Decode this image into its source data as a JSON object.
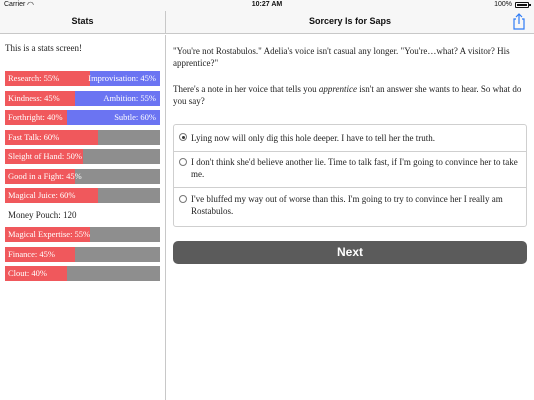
{
  "status_bar": {
    "carrier": "Carrier",
    "time": "10:27 AM",
    "battery": "100%"
  },
  "sidebar": {
    "title": "Stats",
    "intro": "This is a stats screen!",
    "stats": [
      {
        "label": "Research: 55%",
        "right_label": "Improvisation: 45%",
        "value": 55,
        "opposed": true
      },
      {
        "label": "Kindness: 45%",
        "right_label": "Ambition: 55%",
        "value": 45,
        "opposed": true
      },
      {
        "label": "Forthright: 40%",
        "right_label": "Subtle: 60%",
        "value": 40,
        "opposed": true
      },
      {
        "label": "Fast Talk: 60%",
        "value": 60
      },
      {
        "label": "Sleight of Hand: 50%",
        "value": 50
      },
      {
        "label": "Good in a Fight: 45%",
        "value": 45
      },
      {
        "label": "Magical Juice: 60%",
        "value": 60
      },
      {
        "label": "Money Pouch: 120",
        "plain": true
      },
      {
        "label": "Magical Expertise: 55%",
        "value": 55
      },
      {
        "label": "Finance: 45%",
        "value": 45
      },
      {
        "label": "Clout: 40%",
        "value": 40
      }
    ]
  },
  "main": {
    "title": "Sorcery Is for Saps",
    "para1": "\"You're not Rostabulos.\" Adelia's voice isn't casual any longer. \"You're…what? A visitor? His apprentice?\"",
    "para2_a": "There's a note in her voice that tells you ",
    "para2_em": "apprentice",
    "para2_b": " isn't an answer she wants to hear. So what do you say?",
    "choices": [
      {
        "text": "Lying now will only dig this hole deeper. I have to tell her the truth.",
        "selected": true
      },
      {
        "text": "I don't think she'd believe another lie. Time to talk fast, if I'm going to convince her to take me.",
        "selected": false
      },
      {
        "text": "I've bluffed my way out of worse than this. I'm going to try to convince her I really am Rostabulos.",
        "selected": false
      }
    ],
    "next_label": "Next"
  },
  "colors": {
    "red": "#f0585c",
    "blue": "#6b74f2",
    "track": "#8e8e8e",
    "button": "#5b5b5b"
  }
}
